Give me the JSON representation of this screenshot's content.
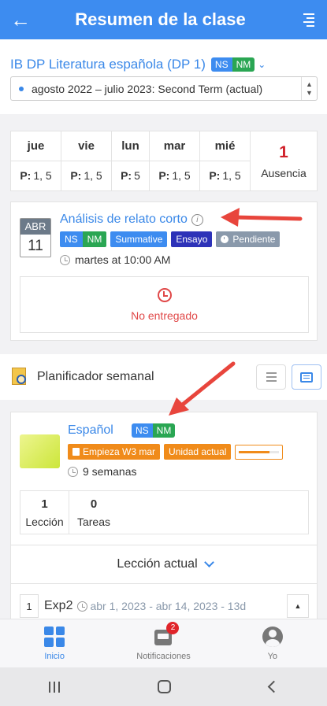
{
  "header": {
    "title": "Resumen de la clase"
  },
  "class": {
    "name": "IB DP Literatura española (DP 1)",
    "level_ns": "NS",
    "level_nm": "NM",
    "term": "agosto 2022 – julio 2023: Second Term (actual)"
  },
  "attendance": {
    "days": [
      {
        "name": "jue",
        "prefix": "P:",
        "value": "1, 5"
      },
      {
        "name": "vie",
        "prefix": "P:",
        "value": "1, 5"
      },
      {
        "name": "lun",
        "prefix": "P:",
        "value": "5"
      },
      {
        "name": "mar",
        "prefix": "P:",
        "value": "1, 5"
      },
      {
        "name": "mié",
        "prefix": "P:",
        "value": "1, 5"
      }
    ],
    "absence_count": "1",
    "absence_label": "Ausencia"
  },
  "assignment": {
    "month": "ABR",
    "day": "11",
    "title": "Análisis de relato corto",
    "info_glyph": "i",
    "tags": {
      "ns": "NS",
      "nm": "NM",
      "summative": "Summative",
      "essay": "Ensayo",
      "pending": "Pendiente"
    },
    "time": "martes at 10:00 AM",
    "status": "No entregado"
  },
  "planner": {
    "title": "Planificador semanal"
  },
  "unit": {
    "name": "Español",
    "level_ns": "NS",
    "level_nm": "NM",
    "starts": "Empieza W3 mar",
    "current_unit": "Unidad actual",
    "progress": 0.75,
    "weeks": "9 semanas",
    "lessons_count": "1",
    "lessons_label": "Lección",
    "tasks_count": "0",
    "tasks_label": "Tareas",
    "current_lesson": "Lección actual",
    "lesson": {
      "index": "1",
      "name": "Exp2",
      "range": "abr 1, 2023 - abr 14, 2023 - 13d"
    }
  },
  "tabs": [
    {
      "label": "Inicio",
      "active": true
    },
    {
      "label": "Notificaciones",
      "badge": "2"
    },
    {
      "label": "Yo"
    }
  ],
  "colors": {
    "primary": "#3d8cf0",
    "green": "#2aa653",
    "orange": "#f08b1a",
    "red": "#e04848",
    "annotation": "#e8453c"
  }
}
